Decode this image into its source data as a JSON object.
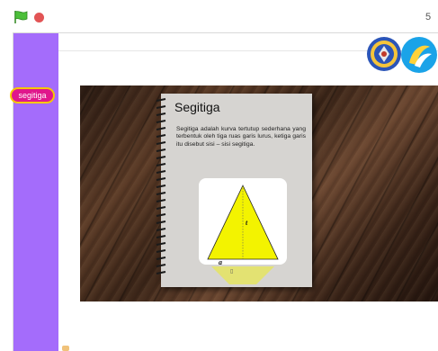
{
  "toolbar": {
    "green_flag_icon": "green-flag-icon",
    "stop_icon": "stop-icon",
    "fullscreen_label": "5"
  },
  "sidebar": {
    "button_label": "segitiga",
    "color": "#a46cfb"
  },
  "lesson": {
    "title": "Segitiga",
    "text": "Segitiga adalah kurva tertutup sederhana yang terbentuk oleh tiga ruas garis lurus, ketiga garis itu disebut sisi – sisi segitiga.",
    "height_label": "t",
    "base_label": "a",
    "small_label": "▯"
  },
  "colors": {
    "triangle_fill": "#f3f300",
    "button_fill": "#e0178c",
    "button_border": "#f7c800"
  }
}
